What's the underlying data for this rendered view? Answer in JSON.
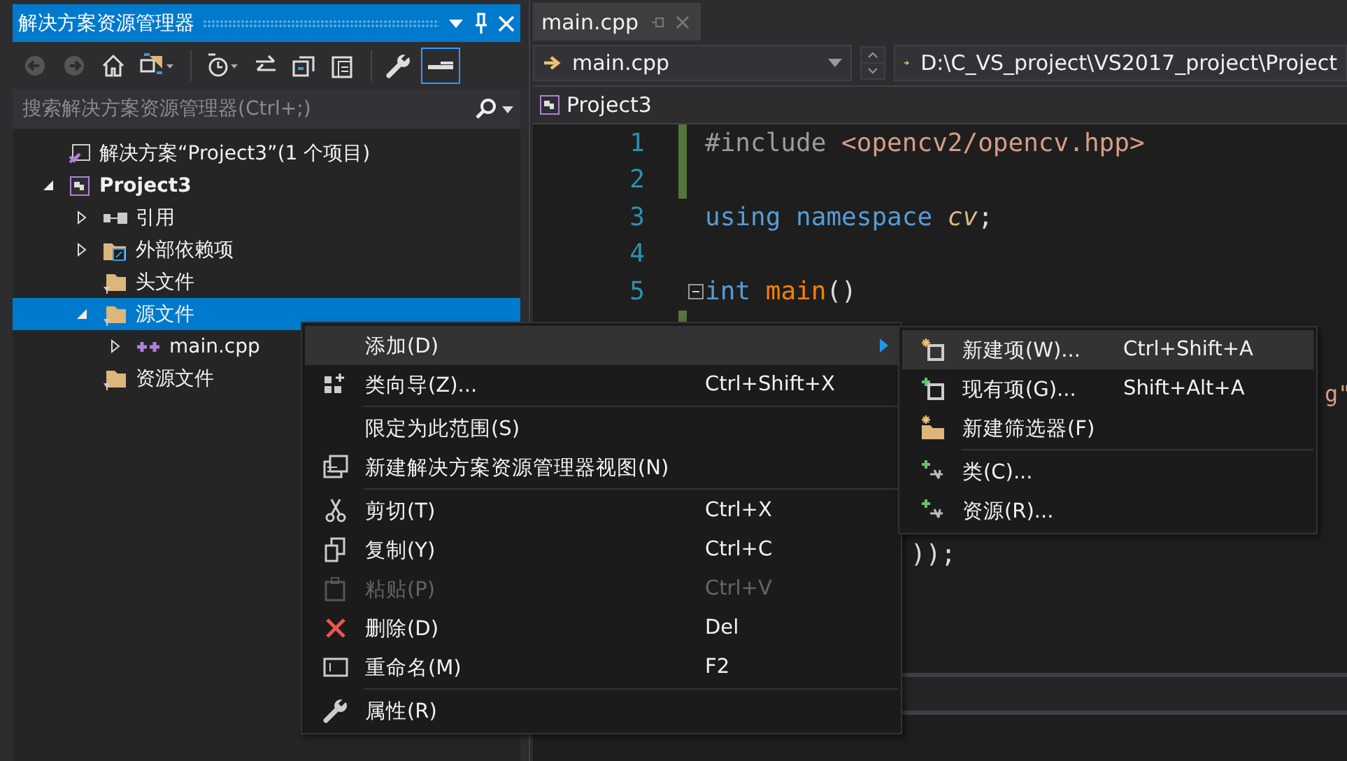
{
  "solution_explorer": {
    "title": "解决方案资源管理器",
    "search": {
      "placeholder": "搜索解决方案资源管理器(Ctrl+;)"
    },
    "tree": [
      {
        "label": "解决方案“Project3”(1 个项目)",
        "kind": "solution",
        "selected": false,
        "children": [
          {
            "label": "Project3",
            "kind": "project",
            "expanded": true,
            "selected": false,
            "children": [
              {
                "label": "引用",
                "kind": "references",
                "expanded": false,
                "selected": false
              },
              {
                "label": "外部依赖项",
                "kind": "external",
                "expanded": false,
                "selected": false
              },
              {
                "label": "头文件",
                "kind": "filter",
                "selected": false
              },
              {
                "label": "源文件",
                "kind": "filter",
                "expanded": true,
                "selected": true,
                "children": [
                  {
                    "label": "main.cpp",
                    "kind": "cpp",
                    "expanded": false,
                    "selected": false
                  }
                ]
              },
              {
                "label": "资源文件",
                "kind": "filter",
                "selected": false
              }
            ]
          }
        ]
      }
    ]
  },
  "editor": {
    "tabs": [
      {
        "label": "main.cpp",
        "selected": true
      }
    ],
    "nav": {
      "file": "main.cpp",
      "path": "D:\\C_VS_project\\VS2017_project\\Project"
    },
    "project": "Project3",
    "lines": [
      {
        "number": "1",
        "changed": true,
        "tokens": [
          {
            "text": "#include ",
            "kind": "preproc"
          },
          {
            "text": "<opencv2/opencv.hpp>",
            "kind": "string"
          }
        ]
      },
      {
        "number": "2",
        "changed": true
      },
      {
        "number": "3",
        "changed": false,
        "tokens": [
          {
            "text": "using namespace ",
            "kind": "keyword"
          },
          {
            "text": "cv",
            "kind": "namespace"
          },
          {
            "text": ";",
            "kind": "plain"
          }
        ]
      },
      {
        "number": "4",
        "changed": false
      },
      {
        "number": "5",
        "changed": false,
        "fold": true,
        "tokens": [
          {
            "text": "int ",
            "kind": "keyword"
          },
          {
            "text": "main",
            "kind": "function"
          },
          {
            "text": "()",
            "kind": "plain"
          }
        ]
      },
      {
        "changed": true
      }
    ],
    "fragments": [
      {
        "text": "g\"",
        "kind": "string"
      },
      {
        "text": "));",
        "kind": "plain"
      }
    ]
  },
  "context_menu": {
    "groups": [
      [
        {
          "label": "添加(D)",
          "kind": "plain",
          "submenu": true,
          "disabled": false,
          "selected": true
        },
        {
          "label": "类向导(Z)...",
          "shortcut": "Ctrl+Shift+X",
          "kind": "wizard",
          "submenu": false,
          "disabled": false,
          "selected": false
        }
      ],
      [
        {
          "label": "限定为此范围(S)",
          "kind": "plain",
          "submenu": false,
          "disabled": false,
          "selected": false
        },
        {
          "label": "新建解决方案资源管理器视图(N)",
          "kind": "newview",
          "submenu": false,
          "disabled": false,
          "selected": false
        }
      ],
      [
        {
          "label": "剪切(T)",
          "shortcut": "Ctrl+X",
          "kind": "cut",
          "submenu": false,
          "disabled": false,
          "selected": false
        },
        {
          "label": "复制(Y)",
          "shortcut": "Ctrl+C",
          "kind": "copy",
          "submenu": false,
          "disabled": false,
          "selected": false
        },
        {
          "label": "粘贴(P)",
          "shortcut": "Ctrl+V",
          "kind": "paste",
          "submenu": false,
          "disabled": true,
          "selected": false
        },
        {
          "label": "删除(D)",
          "shortcut": "Del",
          "kind": "delete",
          "submenu": false,
          "disabled": false,
          "selected": false
        },
        {
          "label": "重命名(M)",
          "shortcut": "F2",
          "kind": "rename",
          "submenu": false,
          "disabled": false,
          "selected": false
        }
      ],
      [
        {
          "label": "属性(R)",
          "kind": "wrench",
          "submenu": false,
          "disabled": false,
          "selected": false
        }
      ]
    ]
  },
  "submenu": {
    "groups": [
      [
        {
          "label": "新建项(W)...",
          "shortcut": "Ctrl+Shift+A",
          "kind": "newitem",
          "submenu": false,
          "disabled": false,
          "selected": true
        },
        {
          "label": "现有项(G)...",
          "shortcut": "Shift+Alt+A",
          "kind": "existing",
          "submenu": false,
          "disabled": false,
          "selected": false
        },
        {
          "label": "新建筛选器(F)",
          "kind": "newfilter",
          "submenu": false,
          "disabled": false,
          "selected": false
        }
      ],
      [
        {
          "label": "类(C)...",
          "kind": "addclass",
          "submenu": false,
          "disabled": false,
          "selected": false
        },
        {
          "label": "资源(R)...",
          "kind": "addclass",
          "submenu": false,
          "disabled": false,
          "selected": false
        }
      ]
    ]
  }
}
